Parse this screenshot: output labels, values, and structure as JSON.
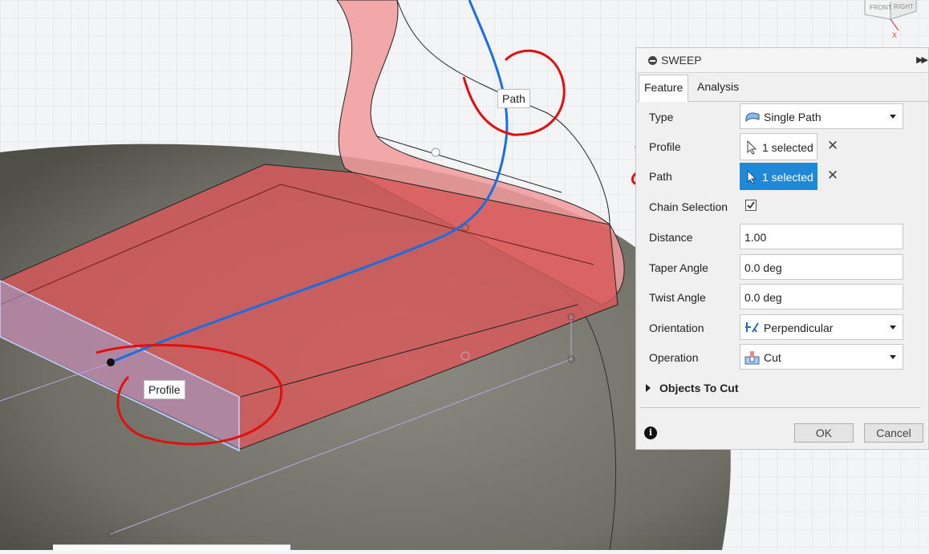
{
  "viewport": {
    "annotations": {
      "path_tag": "Path",
      "profile_tag": "Profile"
    },
    "viewcube": {
      "front": "FRONT",
      "right": "RIGHT",
      "axis_x": "X"
    }
  },
  "dialog": {
    "title": "SWEEP",
    "expand_icon": "double-chevron-right-icon",
    "tabs": [
      {
        "label": "Feature",
        "active": true
      },
      {
        "label": "Analysis",
        "active": false
      }
    ],
    "type": {
      "label": "Type",
      "value": "Single Path",
      "icon": "single-path-icon"
    },
    "profile": {
      "label": "Profile",
      "value": "1 selected",
      "active": false
    },
    "path": {
      "label": "Path",
      "value": "1 selected",
      "active": true
    },
    "clear_glyph": "✕",
    "chain_selection": {
      "label": "Chain Selection",
      "checked": true
    },
    "distance": {
      "label": "Distance",
      "value": "1.00"
    },
    "taper_angle": {
      "label": "Taper Angle",
      "value": "0.0 deg"
    },
    "twist_angle": {
      "label": "Twist Angle",
      "value": "0.0 deg"
    },
    "orientation": {
      "label": "Orientation",
      "value": "Perpendicular",
      "icon": "perpendicular-icon"
    },
    "operation": {
      "label": "Operation",
      "value": "Cut",
      "icon": "cut-icon"
    },
    "objects_section": "Objects To Cut",
    "info_glyph": "i",
    "ok_label": "OK",
    "cancel_label": "Cancel"
  },
  "colors": {
    "accent": "#1f88d7",
    "body_red": "#e05050",
    "path_blue": "#1a6fe0",
    "markup_red": "#e01010",
    "base_gray": "#7a7a70"
  }
}
